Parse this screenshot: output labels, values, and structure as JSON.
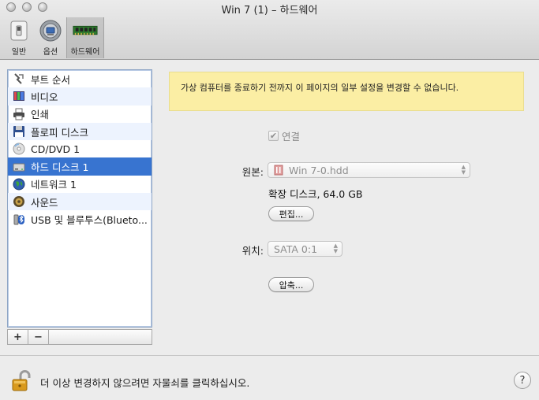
{
  "window": {
    "title": "Win 7 (1) – 하드웨어"
  },
  "toolbar": {
    "items": [
      {
        "label": "일반",
        "icon": "general-switch-icon"
      },
      {
        "label": "옵션",
        "icon": "options-gear-icon"
      },
      {
        "label": "하드웨어",
        "icon": "hardware-chip-icon",
        "selected": true
      }
    ]
  },
  "sidebar": {
    "items": [
      {
        "label": "부트 순서",
        "icon": "boot-order-icon"
      },
      {
        "label": "비디오",
        "icon": "video-icon"
      },
      {
        "label": "인쇄",
        "icon": "printer-icon"
      },
      {
        "label": "플로피 디스크",
        "icon": "floppy-disk-icon"
      },
      {
        "label": "CD/DVD 1",
        "icon": "cd-dvd-icon"
      },
      {
        "label": "하드 디스크  1",
        "icon": "hard-disk-icon",
        "selected": true
      },
      {
        "label": "네트워크 1",
        "icon": "network-globe-icon"
      },
      {
        "label": "사운드",
        "icon": "speaker-icon"
      },
      {
        "label": "USB 및 블루투스(Blueto...",
        "icon": "usb-bluetooth-icon"
      }
    ],
    "add_label": "+",
    "remove_label": "−"
  },
  "notice": {
    "text": "가상 컴퓨터를 종료하기 전까지 이 페이지의 일부 설정을 변경할 수 없습니다."
  },
  "form": {
    "connect_label": "연결",
    "connect_checked": true,
    "source_label": "원본:",
    "source_value": "Win 7-0.hdd",
    "disk_type": "확장 디스크, 64.0 GB",
    "edit_button": "편집...",
    "location_label": "위치:",
    "location_value": "SATA 0:1",
    "compress_button": "압축..."
  },
  "footer": {
    "lock_text": "더 이상 변경하지 않으려면 자물쇠를 클릭하십시오.",
    "help_label": "?"
  },
  "colors": {
    "selection": "#3874d0",
    "notice_background": "#fbeea4",
    "alt_row": "#edf3fe"
  }
}
